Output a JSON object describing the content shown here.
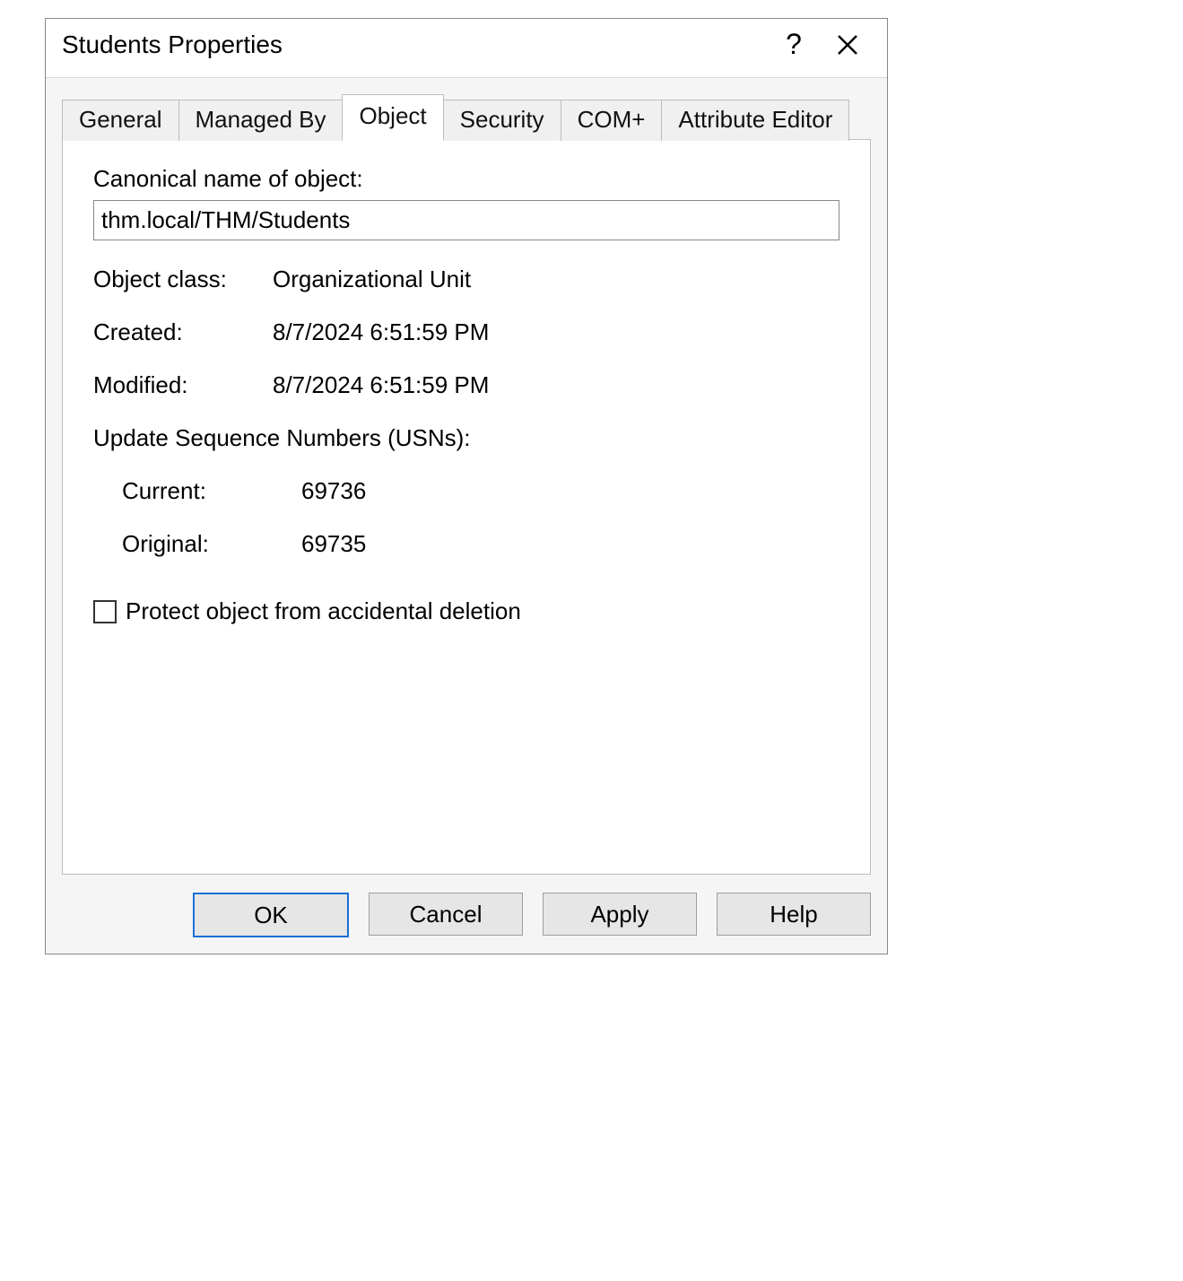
{
  "window": {
    "title": "Students Properties",
    "help_symbol": "?",
    "close_symbol": "×"
  },
  "tabs": [
    {
      "label": "General"
    },
    {
      "label": "Managed By"
    },
    {
      "label": "Object"
    },
    {
      "label": "Security"
    },
    {
      "label": "COM+"
    },
    {
      "label": "Attribute Editor"
    }
  ],
  "active_tab_index": 2,
  "object_tab": {
    "canonical_label": "Canonical name of object:",
    "canonical_value": "thm.local/THM/Students",
    "class_label": "Object class:",
    "class_value": "Organizational Unit",
    "created_label": "Created:",
    "created_value": "8/7/2024 6:51:59 PM",
    "modified_label": "Modified:",
    "modified_value": "8/7/2024 6:51:59 PM",
    "usn_header": "Update Sequence Numbers (USNs):",
    "usn_current_label": "Current:",
    "usn_current_value": "69736",
    "usn_original_label": "Original:",
    "usn_original_value": "69735",
    "protect_label": "Protect object from accidental deletion",
    "protect_checked": false
  },
  "buttons": {
    "ok": "OK",
    "cancel": "Cancel",
    "apply": "Apply",
    "help": "Help"
  }
}
